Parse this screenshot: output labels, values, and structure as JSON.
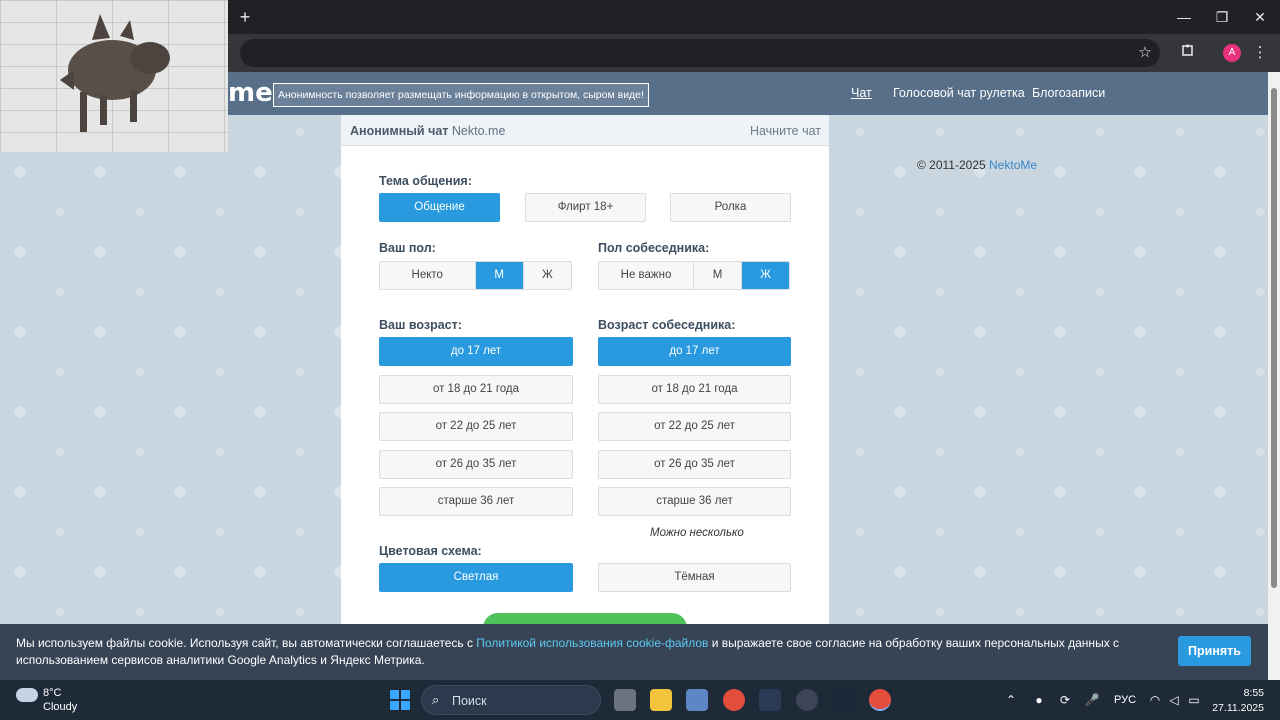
{
  "browser": {
    "new_tab_glyph": "+",
    "minimize_glyph": "—",
    "restore_glyph": "❐",
    "close_glyph": "✕",
    "bookmark_icon": "star-icon",
    "extensions_icon": "puzzle-icon",
    "profile_initial": "A",
    "menu_glyph": "⋮"
  },
  "site": {
    "logo": "me",
    "tagline": "Анонимность позволяет размещать информацию в открытом, сыром виде!",
    "nav": [
      "Чат",
      "Голосовой чат рулетка",
      "Блогозаписи"
    ],
    "copyright_prefix": "© 2011-2025 ",
    "copyright_link": "NektoMe"
  },
  "panel": {
    "title": "Анонимный чат",
    "site": "Nekto.me",
    "start": "Начните чат",
    "topic_label": "Тема общения:",
    "topics": [
      {
        "label": "Общение",
        "active": true
      },
      {
        "label": "Флирт 18+",
        "active": false
      },
      {
        "label": "Ролка",
        "active": false
      }
    ],
    "my_gender_label": "Ваш пол:",
    "my_gender": [
      {
        "label": "Некто",
        "active": false
      },
      {
        "label": "М",
        "active": true
      },
      {
        "label": "Ж",
        "active": false
      }
    ],
    "partner_gender_label": "Пол собеседника:",
    "partner_gender": [
      {
        "label": "Не важно",
        "active": false
      },
      {
        "label": "М",
        "active": false
      },
      {
        "label": "Ж",
        "active": true
      }
    ],
    "my_age_label": "Ваш возраст:",
    "my_age": [
      {
        "label": "до 17 лет",
        "active": true
      },
      {
        "label": "от 18 до 21 года",
        "active": false
      },
      {
        "label": "от 22 до 25 лет",
        "active": false
      },
      {
        "label": "от 26 до 35 лет",
        "active": false
      },
      {
        "label": "старше 36 лет",
        "active": false
      }
    ],
    "partner_age_label": "Возраст собеседника:",
    "partner_age": [
      {
        "label": "до 17 лет",
        "active": true
      },
      {
        "label": "от 18 до 21 года",
        "active": false
      },
      {
        "label": "от 22 до 25 лет",
        "active": false
      },
      {
        "label": "от 26 до 35 лет",
        "active": false
      },
      {
        "label": "старше 36 лет",
        "active": false
      }
    ],
    "multi_hint": "Можно несколько",
    "theme_label": "Цветовая схема:",
    "themes": [
      {
        "label": "Светлая",
        "active": true
      },
      {
        "label": "Тёмная",
        "active": false
      }
    ]
  },
  "cookie": {
    "text_before": "Мы используем файлы cookie. Используя сайт, вы автоматически соглашаетесь с ",
    "link": "Политикой использования cookie-файлов",
    "text_after": " и выражаете свое согласие на обработку ваших персональных данных с использованием сервисов аналитики Google Analytics и Яндекс Метрика.",
    "accept": "Принять"
  },
  "taskbar": {
    "temp": "8°C",
    "weather": "Cloudy",
    "search": "Поиск",
    "lang": "РУС",
    "time": "8:55",
    "date": "27.11.2025"
  },
  "colors": {
    "accent": "#2a9ae0",
    "header": "#586f89",
    "cookie_bg": "#364456"
  }
}
